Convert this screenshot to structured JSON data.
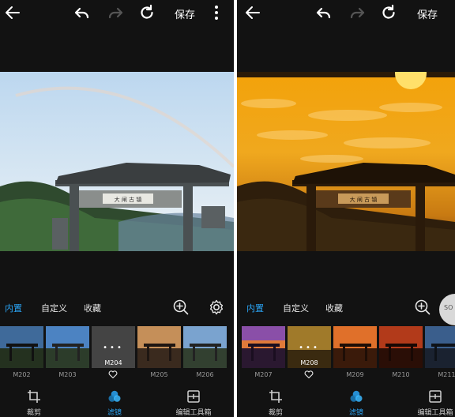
{
  "left": {
    "topbar": {
      "back_icon": "arrow-left-icon",
      "undo_icon": "undo-icon",
      "redo_icon": "redo-icon",
      "reset_icon": "reset-icon",
      "save_label": "保存",
      "more_icon": "more-vertical-icon"
    },
    "tabs": [
      {
        "label": "内置",
        "active": true
      },
      {
        "label": "自定义",
        "active": false
      },
      {
        "label": "收藏",
        "active": false
      }
    ],
    "tools": {
      "zoom_icon": "zoom-in-icon",
      "settings_icon": "gear-icon"
    },
    "filters": [
      {
        "label": "M202",
        "tone": "#3f6a9a",
        "selected": false
      },
      {
        "label": "M203",
        "tone": "#4c83c2",
        "selected": false
      },
      {
        "label": "M204",
        "tone": "#444444",
        "selected": true
      },
      {
        "label": "M205",
        "tone": "#c58f59",
        "selected": false
      },
      {
        "label": "M206",
        "tone": "#7aa3cf",
        "selected": false
      }
    ],
    "bottom": [
      {
        "label": "裁剪",
        "icon": "crop-icon",
        "active": false
      },
      {
        "label": "滤镜",
        "icon": "filter-icon",
        "active": true
      },
      {
        "label": "编辑工具箱",
        "icon": "toolbox-icon",
        "active": false
      }
    ],
    "photo": {
      "sign_text": "大 闸 古 镇"
    }
  },
  "right": {
    "topbar": {
      "back_icon": "arrow-left-icon",
      "undo_icon": "undo-icon",
      "redo_icon": "redo-icon",
      "reset_icon": "reset-icon",
      "save_label": "保存"
    },
    "tabs": [
      {
        "label": "内置",
        "active": true
      },
      {
        "label": "自定义",
        "active": false
      },
      {
        "label": "收藏",
        "active": false
      }
    ],
    "tools": {
      "zoom_icon": "zoom-in-icon"
    },
    "filters": [
      {
        "label": "M207",
        "tone": "#8a4fa8",
        "selected": false
      },
      {
        "label": "M208",
        "tone": "#a07a2a",
        "selected": true
      },
      {
        "label": "M209",
        "tone": "#e0702a",
        "selected": false
      },
      {
        "label": "M210",
        "tone": "#b23a1a",
        "selected": false
      },
      {
        "label": "M211",
        "tone": "#3a5e8c",
        "selected": false
      }
    ],
    "bottom": [
      {
        "label": "裁剪",
        "icon": "crop-icon",
        "active": false
      },
      {
        "label": "滤镜",
        "icon": "filter-icon",
        "active": true
      },
      {
        "label": "编辑工具箱",
        "icon": "toolbox-icon",
        "active": false
      }
    ],
    "photo": {
      "sign_text": "大 闸 古 镇"
    }
  },
  "overlay": {
    "badge_text": "SO"
  },
  "colors": {
    "accent": "#2aa4f4",
    "background": "#121212"
  }
}
